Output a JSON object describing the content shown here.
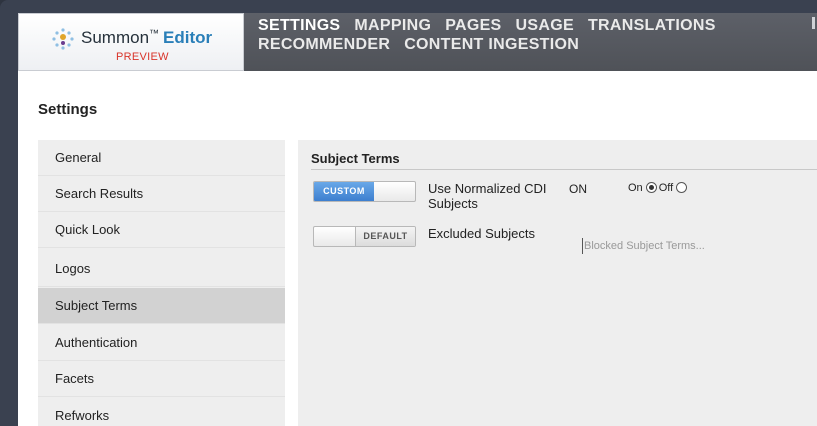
{
  "logo": {
    "name": "Summon",
    "tm": "™",
    "editor": "Editor",
    "preview": "PREVIEW"
  },
  "nav": {
    "items": [
      {
        "label": "SETTINGS"
      },
      {
        "label": "MAPPING"
      },
      {
        "label": "PAGES"
      },
      {
        "label": "USAGE"
      },
      {
        "label": "TRANSLATIONS"
      },
      {
        "label": "RECOMMENDER"
      },
      {
        "label": "CONTENT INGESTION"
      }
    ]
  },
  "page": {
    "title": "Settings"
  },
  "sidebar": {
    "items": [
      {
        "label": "General"
      },
      {
        "label": "Search Results"
      },
      {
        "label": "Quick Look"
      },
      {
        "label": "Logos"
      },
      {
        "label": "Subject Terms"
      },
      {
        "label": "Authentication"
      },
      {
        "label": "Facets"
      },
      {
        "label": "Refworks"
      }
    ],
    "active": "Subject Terms"
  },
  "panel": {
    "title": "Subject Terms",
    "settings": [
      {
        "toggle_label": "CUSTOM",
        "label": "Use Normalized CDI Subjects",
        "value": "ON",
        "radio_on": "On",
        "radio_off": "Off",
        "selected": "On"
      },
      {
        "toggle_label": "DEFAULT",
        "label": "Excluded Subjects",
        "placeholder": "Blocked Subject Terms..."
      }
    ]
  },
  "colors": {
    "header_bg": "#55585f",
    "accent_blue": "#3d7fcf",
    "preview_red": "#d9342a",
    "sidebar_active": "#d2d2d2"
  }
}
